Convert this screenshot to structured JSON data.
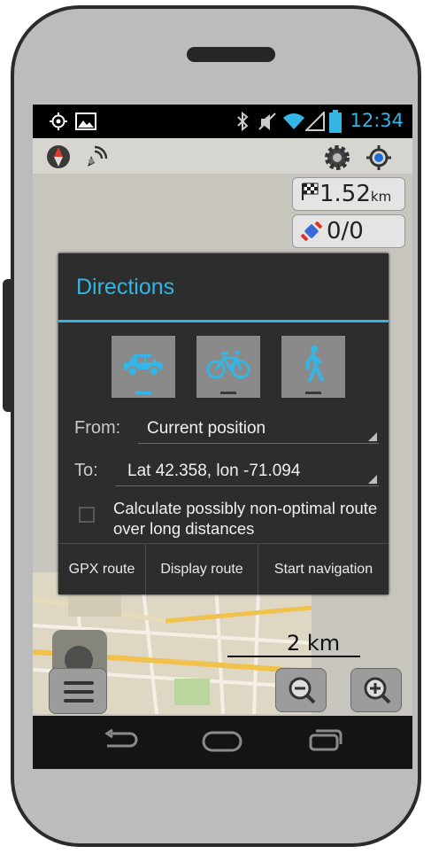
{
  "status_bar": {
    "time": "12:34",
    "icons": [
      "gps-icon",
      "image-icon",
      "bluetooth-icon",
      "mute-icon",
      "wifi-icon",
      "signal-icon",
      "battery-icon"
    ]
  },
  "map_overlay": {
    "distance_value": "1.52",
    "distance_unit": "km",
    "satellites": "0/0",
    "scale": "2 km"
  },
  "dialog": {
    "title": "Directions",
    "modes": [
      {
        "name": "car",
        "selected": true
      },
      {
        "name": "bicycle",
        "selected": false
      },
      {
        "name": "pedestrian",
        "selected": false
      }
    ],
    "from_label": "From:",
    "from_value": "Current position",
    "to_label": "To:",
    "to_value": "Lat 42.358, lon -71.094",
    "checkbox_label": "Calculate possibly non-optimal route over long distances",
    "checkbox_checked": false,
    "buttons": {
      "gpx": "GPX route",
      "display": "Display route",
      "start": "Start navigation"
    }
  },
  "colors": {
    "accent": "#33b5e5",
    "dialog_bg": "#2d2d2d",
    "map_bg": "#c7c5bd"
  }
}
